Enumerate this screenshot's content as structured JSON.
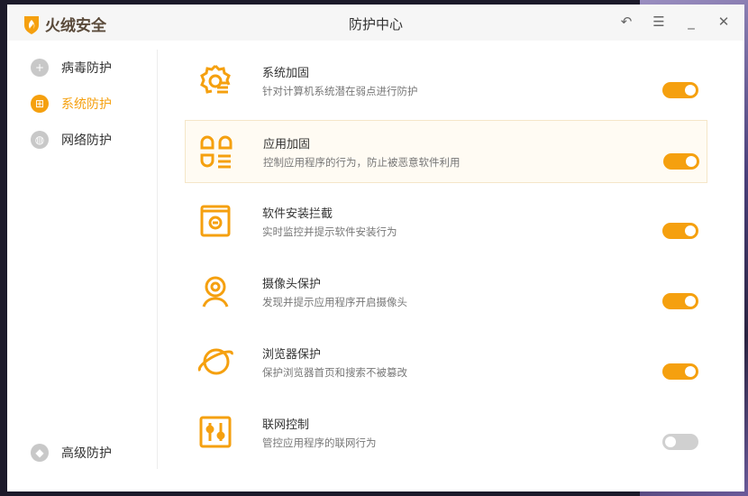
{
  "app": {
    "name": "火绒安全",
    "title": "防护中心"
  },
  "controls": {
    "back": "↶",
    "menu": "☰",
    "minimize": "_",
    "close": "✕"
  },
  "sidebar": {
    "items": [
      {
        "label": "病毒防护",
        "active": false
      },
      {
        "label": "系统防护",
        "active": true
      },
      {
        "label": "网络防护",
        "active": false
      },
      {
        "label": "高级防护",
        "active": false
      }
    ]
  },
  "items": [
    {
      "title": "系统加固",
      "desc": "针对计算机系统潜在弱点进行防护",
      "on": true
    },
    {
      "title": "应用加固",
      "desc": "控制应用程序的行为，防止被恶意软件利用",
      "on": true
    },
    {
      "title": "软件安装拦截",
      "desc": "实时监控并提示软件安装行为",
      "on": true
    },
    {
      "title": "摄像头保护",
      "desc": "发现并提示应用程序开启摄像头",
      "on": true
    },
    {
      "title": "浏览器保护",
      "desc": "保护浏览器首页和搜索不被篡改",
      "on": true
    },
    {
      "title": "联网控制",
      "desc": "管控应用程序的联网行为",
      "on": false
    }
  ],
  "colors": {
    "accent": "#f5a00f"
  }
}
